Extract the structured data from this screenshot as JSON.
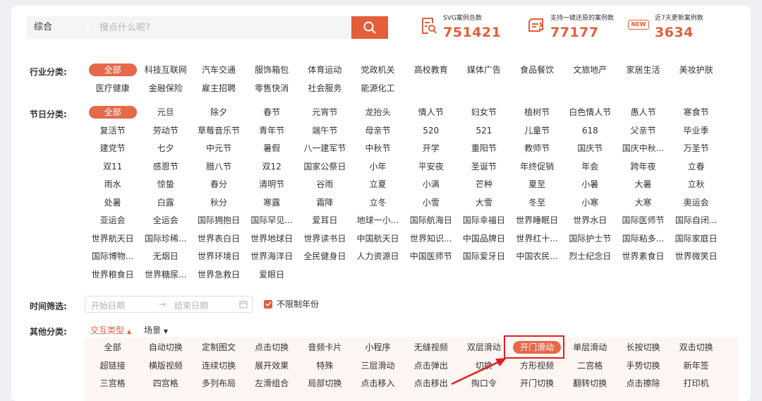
{
  "search": {
    "category": "综合",
    "placeholder": "搜点什么呢?",
    "button_icon": "search-icon"
  },
  "stats": [
    {
      "icon": "document-search-icon",
      "label": "SVG案例总数",
      "value": "751421"
    },
    {
      "icon": "one-click-restore-icon",
      "label": "支持一键还原的案例数",
      "value": "77177"
    },
    {
      "icon": "new-badge-icon",
      "badge": "NEW",
      "label": "近7天更新案例数",
      "value": "3634"
    }
  ],
  "industry": {
    "label": "行业分类:",
    "items": [
      "全部",
      "科技互联网",
      "汽车交通",
      "服饰箱包",
      "体育运动",
      "党政机关",
      "高校教育",
      "媒体广告",
      "食品餐饮",
      "文旅地产",
      "家居生活",
      "美妆护肤",
      "医疗健康",
      "金融保险",
      "雇主招聘",
      "零售快消",
      "社会服务",
      "能源化工"
    ],
    "selected": 0
  },
  "festival": {
    "label": "节日分类:",
    "items": [
      "全部",
      "元旦",
      "除夕",
      "春节",
      "元宵节",
      "龙抬头",
      "情人节",
      "妇女节",
      "植树节",
      "白色情人节",
      "愚人节",
      "寒食节",
      "复活节",
      "劳动节",
      "草莓音乐节",
      "青年节",
      "端午节",
      "母亲节",
      "520",
      "521",
      "儿童节",
      "618",
      "父亲节",
      "毕业季",
      "建党节",
      "七夕",
      "中元节",
      "暑假",
      "八一建军节",
      "中秋节",
      "开学",
      "重阳节",
      "教师节",
      "国庆节",
      "国庆中秋...",
      "万圣节",
      "双11",
      "感恩节",
      "腊八节",
      "双12",
      "国家公祭日",
      "小年",
      "平安夜",
      "圣诞节",
      "年终促销",
      "年会",
      "跨年夜",
      "立春",
      "雨水",
      "惊蛰",
      "春分",
      "清明节",
      "谷雨",
      "立夏",
      "小满",
      "芒种",
      "夏至",
      "小暑",
      "大暑",
      "立秋",
      "处暑",
      "白露",
      "秋分",
      "寒露",
      "霜降",
      "立冬",
      "小雪",
      "大雪",
      "冬至",
      "小寒",
      "大寒",
      "奥运会",
      "亚运会",
      "全运会",
      "国际拥抱日",
      "国际罕见...",
      "爱耳日",
      "地球一小...",
      "国际航海日",
      "国际幸福日",
      "世界睡眠日",
      "世界水日",
      "国际医师节",
      "国际自闭...",
      "世界航天日",
      "国际珍稀...",
      "世界表白日",
      "世界地球日",
      "世界读书日",
      "中国航天日",
      "世界知识...",
      "中国品牌日",
      "世界红十...",
      "国际护士节",
      "国际粘多...",
      "国际家庭日",
      "国际博物...",
      "无烟日",
      "世界环境日",
      "世界海洋日",
      "全民健身日",
      "人力资源日",
      "中国医师节",
      "国际爱牙日",
      "中国农民...",
      "烈士纪念日",
      "世界素食日",
      "世界微笑日",
      "世界粮食日",
      "世界糖尿...",
      "世界急救日",
      "爱眼日"
    ],
    "selected": 0
  },
  "time": {
    "label": "时间筛选:",
    "start_placeholder": "开始日期",
    "end_placeholder": "结束日期",
    "separator": "→",
    "unlimited_label": "不限制年份",
    "unlimited_checked": true
  },
  "other": {
    "label": "其他分类:",
    "dropdowns": [
      {
        "label": "交互类型",
        "arrow": "▲",
        "active": true
      },
      {
        "label": "场景",
        "arrow": "▼",
        "active": false
      }
    ],
    "items": [
      "全部",
      "自动切换",
      "定制图文",
      "点击切换",
      "音频卡片",
      "小程序",
      "无缝视频",
      "双层滑动",
      "开门滑动",
      "单层滑动",
      "长按切换",
      "双击切换",
      "超链接",
      "横版视频",
      "连续切换",
      "展开效果",
      "特殊",
      "三层滑动",
      "点击弹出",
      "切换",
      "方形视频",
      "二宫格",
      "手势切换",
      "新年签",
      "三宫格",
      "四宫格",
      "多列布局",
      "左滑组合",
      "局部切换",
      "点击移入",
      "点击移出",
      "掏口令",
      "开门切换",
      "翻转切换",
      "点击擦除",
      "打印机"
    ],
    "selected": 8
  },
  "colors": {
    "accent": "#e45e3a",
    "highlight_border": "#e02020"
  }
}
